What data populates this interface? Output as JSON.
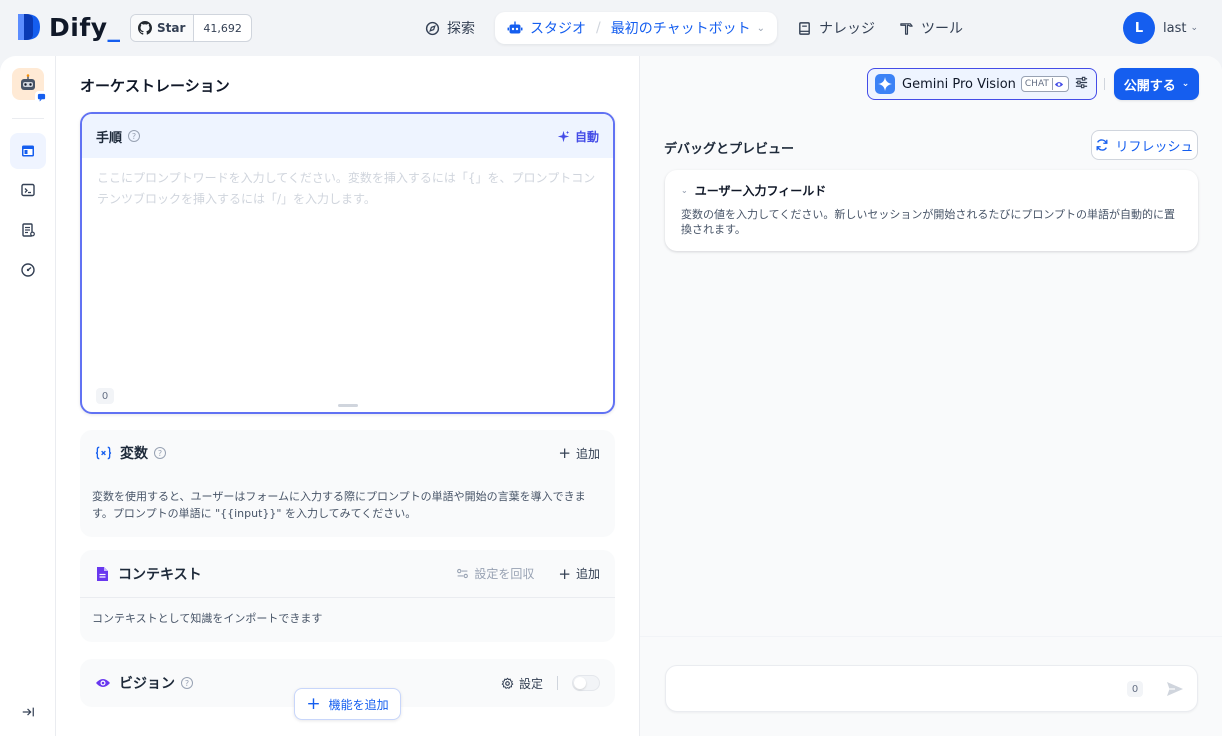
{
  "brand": {
    "name": "Dify",
    "accent": "#155eef"
  },
  "github": {
    "star_label": "Star",
    "count": "41,692"
  },
  "nav": {
    "explore": "探索",
    "studio": "スタジオ",
    "app_name": "最初のチャットボット",
    "knowledge": "ナレッジ",
    "tools": "ツール"
  },
  "user": {
    "initial": "L",
    "name": "last"
  },
  "orchestration": {
    "title": "オーケストレーション",
    "prompt": {
      "label": "手順",
      "auto_label": "自動",
      "placeholder": "ここにプロンプトワードを入力してください。変数を挿入するには「{」を、プロンプトコンテンツブロックを挿入するには「/」を入力します。",
      "char_count": "0"
    },
    "variables": {
      "title": "変数",
      "add_label": "追加",
      "description": "変数を使用すると、ユーザーはフォームに入力する際にプロンプトの単語や開始の言葉を導入できます。プロンプトの単語に \"{{input}}\" を入力してみてください。"
    },
    "context": {
      "title": "コンテキスト",
      "retrieval_settings": "設定を回収",
      "add_label": "追加",
      "description": "コンテキストとして知識をインポートできます"
    },
    "vision": {
      "title": "ビジョン",
      "settings_label": "設定",
      "enabled": false
    },
    "add_feature_label": "機能を追加"
  },
  "model": {
    "name": "Gemini Pro Vision",
    "mode_tag": "CHAT"
  },
  "publish_label": "公開する",
  "debug": {
    "title": "デバッグとプレビュー",
    "refresh_label": "リフレッシュ",
    "user_input_title": "ユーザー入力フィールド",
    "user_input_desc": "変数の値を入力してください。新しいセッションが開始されるたびにプロンプトの単語が自動的に置換されます。",
    "input_count": "0"
  }
}
